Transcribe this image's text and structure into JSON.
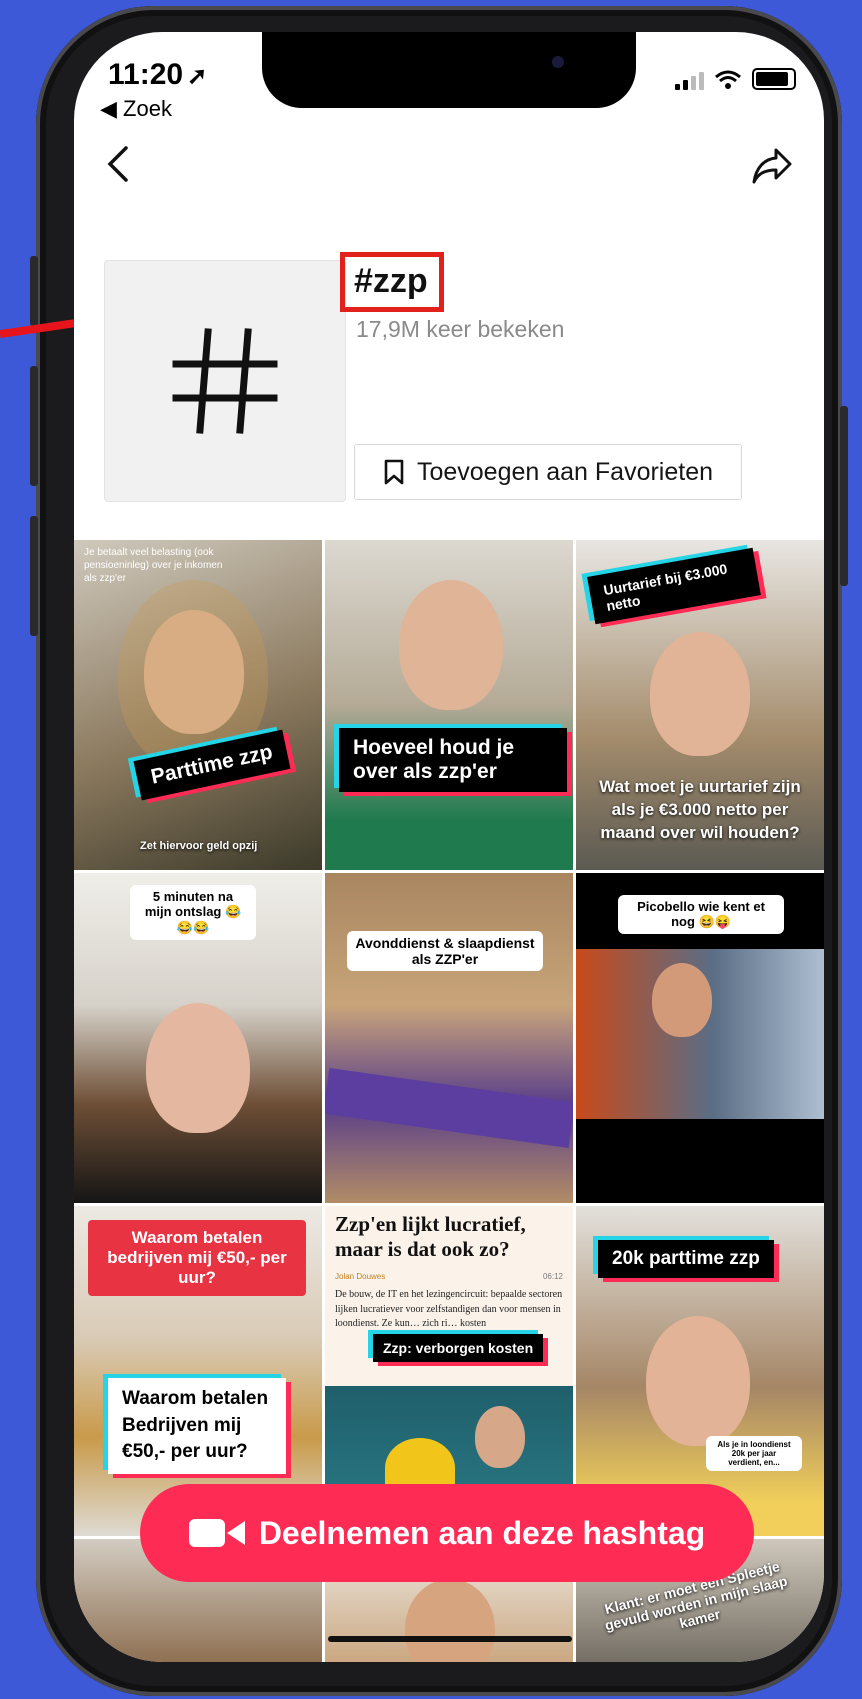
{
  "status_bar": {
    "time": "11:20",
    "back_app": "◀ Zoek"
  },
  "hashtag": {
    "title": "#zzp",
    "views_count": "17,9M",
    "views_label": "keer bekeken",
    "favorite_label": "Toevoegen aan Favorieten"
  },
  "videos": [
    {
      "caption": "Parttime zzp",
      "top_text": "Je betaalt veel belasting (ook pensioeninleg) over je inkomen als zzp'er",
      "bottom_text": "Zet hiervoor geld opzij"
    },
    {
      "caption": "Hoeveel houd je over als zzp'er"
    },
    {
      "caption": "Uurtarief bij €3.000 netto",
      "bottom_text": "Wat moet je uurtarief zijn als je €3.000 netto per maand over wil houden?"
    },
    {
      "caption": "5 minuten na mijn ontslag 😂😂😂"
    },
    {
      "caption": "Avonddienst & slaapdienst als ZZP'er"
    },
    {
      "caption": "Picobello wie kent et nog 😆😝"
    },
    {
      "caption": "Waarom betalen bedrijven mij €50,- per uur?",
      "sub_caption": "Waarom betalen Bedrijven mij €50,- per uur?"
    },
    {
      "article_title": "Zzp'en lijkt lucratief, maar is dat ook zo?",
      "article_author": "Jolan Douwes",
      "article_time": "06:12",
      "article_body": "De bouw, de IT en het lezingencircuit: bepaalde sectoren lijken lucratiever voor zelfstandigen dan voor mensen in loondienst. Ze kun… zich ri… kosten",
      "caption": "Zzp: verborgen kosten"
    },
    {
      "caption": "20k parttime zzp",
      "note": "Als je in loondienst 20k per jaar verdient, en..."
    },
    {},
    {},
    {
      "caption": "Klant: er moet een Spleetje gevuld worden in mijn slaap kamer"
    }
  ],
  "join_button": {
    "label": "Deelnemen aan deze hashtag"
  },
  "colors": {
    "background": "#3d59d8",
    "accent": "#fe2c55",
    "cyan": "#25d4e6",
    "highlight": "#e0211c"
  }
}
